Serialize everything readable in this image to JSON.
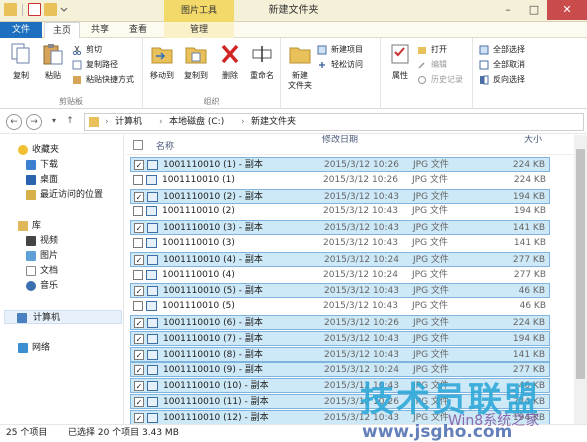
{
  "window": {
    "title": "新建文件夹",
    "context_tools": "图片工具"
  },
  "tabs": {
    "file": "文件",
    "home": "主页",
    "share": "共享",
    "view": "查看",
    "manage": "管理"
  },
  "ribbon": {
    "clipboard": {
      "label": "剪贴板",
      "copy": "复制",
      "paste": "粘贴",
      "cut": "剪切",
      "copy_path": "复制路径",
      "paste_shortcut": "粘贴快捷方式"
    },
    "organize": {
      "label": "组织",
      "move_to": "移动到",
      "copy_to": "复制到",
      "delete": "删除",
      "rename": "重命名"
    },
    "new": {
      "new_folder": "新建\n文件夹",
      "new_item": "新建项目",
      "easy_access": "轻松访问"
    },
    "open": {
      "properties": "属性",
      "open": "打开",
      "edit": "编辑",
      "history": "历史记录"
    },
    "select": {
      "select_all": "全部选择",
      "select_none": "全部取消",
      "invert": "反向选择"
    }
  },
  "address": {
    "parts": [
      "计算机",
      "本地磁盘 (C:)",
      "新建文件夹"
    ]
  },
  "nav": {
    "favorites": "收藏夹",
    "downloads": "下载",
    "desktop": "桌面",
    "recent": "最近访问的位置",
    "libraries": "库",
    "videos": "视频",
    "pictures": "图片",
    "documents": "文档",
    "music": "音乐",
    "computer": "计算机",
    "network": "网络"
  },
  "columns": {
    "name": "名称",
    "date": "修改日期",
    "size": "大小"
  },
  "files": [
    {
      "name": "1001110010 (1) - 副本",
      "date": "2015/3/12 10:26",
      "type": "JPG 文件",
      "size": "224 KB",
      "selected": true
    },
    {
      "name": "1001110010 (1)",
      "date": "2015/3/12 10:26",
      "type": "JPG 文件",
      "size": "224 KB",
      "selected": false
    },
    {
      "name": "1001110010 (2) - 副本",
      "date": "2015/3/12 10:43",
      "type": "JPG 文件",
      "size": "194 KB",
      "selected": true
    },
    {
      "name": "1001110010 (2)",
      "date": "2015/3/12 10:43",
      "type": "JPG 文件",
      "size": "194 KB",
      "selected": false
    },
    {
      "name": "1001110010 (3) - 副本",
      "date": "2015/3/12 10:43",
      "type": "JPG 文件",
      "size": "141 KB",
      "selected": true
    },
    {
      "name": "1001110010 (3)",
      "date": "2015/3/12 10:43",
      "type": "JPG 文件",
      "size": "141 KB",
      "selected": false
    },
    {
      "name": "1001110010 (4) - 副本",
      "date": "2015/3/12 10:24",
      "type": "JPG 文件",
      "size": "277 KB",
      "selected": true
    },
    {
      "name": "1001110010 (4)",
      "date": "2015/3/12 10:24",
      "type": "JPG 文件",
      "size": "277 KB",
      "selected": false
    },
    {
      "name": "1001110010 (5) - 副本",
      "date": "2015/3/12 10:43",
      "type": "JPG 文件",
      "size": "46 KB",
      "selected": true
    },
    {
      "name": "1001110010 (5)",
      "date": "2015/3/12 10:43",
      "type": "JPG 文件",
      "size": "46 KB",
      "selected": false
    },
    {
      "name": "1001110010 (6) - 副本",
      "date": "2015/3/12 10:26",
      "type": "JPG 文件",
      "size": "224 KB",
      "selected": true
    },
    {
      "name": "1001110010 (7) - 副本",
      "date": "2015/3/12 10:43",
      "type": "JPG 文件",
      "size": "194 KB",
      "selected": true
    },
    {
      "name": "1001110010 (8) - 副本",
      "date": "2015/3/12 10:43",
      "type": "JPG 文件",
      "size": "141 KB",
      "selected": true
    },
    {
      "name": "1001110010 (9) - 副本",
      "date": "2015/3/12 10:24",
      "type": "JPG 文件",
      "size": "277 KB",
      "selected": true
    },
    {
      "name": "1001110010 (10) - 副本",
      "date": "2015/3/12 10:43",
      "type": "JPG 文件",
      "size": "46 KB",
      "selected": true
    },
    {
      "name": "1001110010 (11) - 副本",
      "date": "2015/3/12 10:26",
      "type": "JPG 文件",
      "size": "224 KB",
      "selected": true
    },
    {
      "name": "1001110010 (12) - 副本",
      "date": "2015/3/12 10:43",
      "type": "JPG 文件",
      "size": "194 KB",
      "selected": true
    }
  ],
  "status": {
    "count": "25 个项目",
    "selected": "已选择 20 个项目  3.43 MB"
  },
  "watermark": {
    "brand": "技术员联盟",
    "url": "www.jsgho.com",
    "sub": "Win8系统之家"
  },
  "colors": {
    "file_tab": "#1e6fbf",
    "selection": "#cde8f7",
    "selection_border": "#7eb4de",
    "context_tab": "#f3d96a"
  }
}
